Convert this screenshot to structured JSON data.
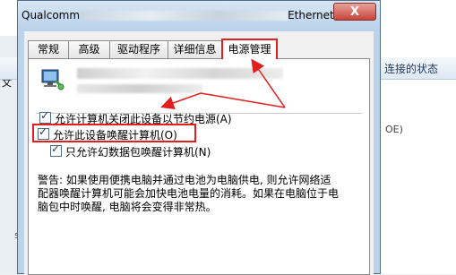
{
  "background_window": {
    "left_text": "文",
    "toolbar_status": "连接的状态",
    "oe_text": "OE)",
    "left_bottom": "ss"
  },
  "dialog": {
    "title_prefix": "Qualcomm",
    "title_suffix": "Ethernet...",
    "close_label": "X",
    "tabs": [
      {
        "label": "常规",
        "active": false
      },
      {
        "label": "高级",
        "active": false
      },
      {
        "label": "驱动程序",
        "active": false
      },
      {
        "label": "详细信息",
        "active": false
      },
      {
        "label": "电源管理",
        "active": true
      }
    ],
    "options": [
      {
        "label": "允许计算机关闭此设备以节约电源(A)",
        "checked": true
      },
      {
        "label": "允许此设备唤醒计算机(O)",
        "checked": true
      },
      {
        "label": "只允许幻数据包唤醒计算机(N)",
        "checked": true
      }
    ],
    "warning": "警告: 如果使用便携电脑并通过电池为电脑供电, 则允许网络适配器唤醒计算机可能会加快电池电量的消耗。如果在电脑位于电脑包中时唤醒, 电脑将会变得非常热。",
    "annotation_color": "#e21e1e"
  }
}
